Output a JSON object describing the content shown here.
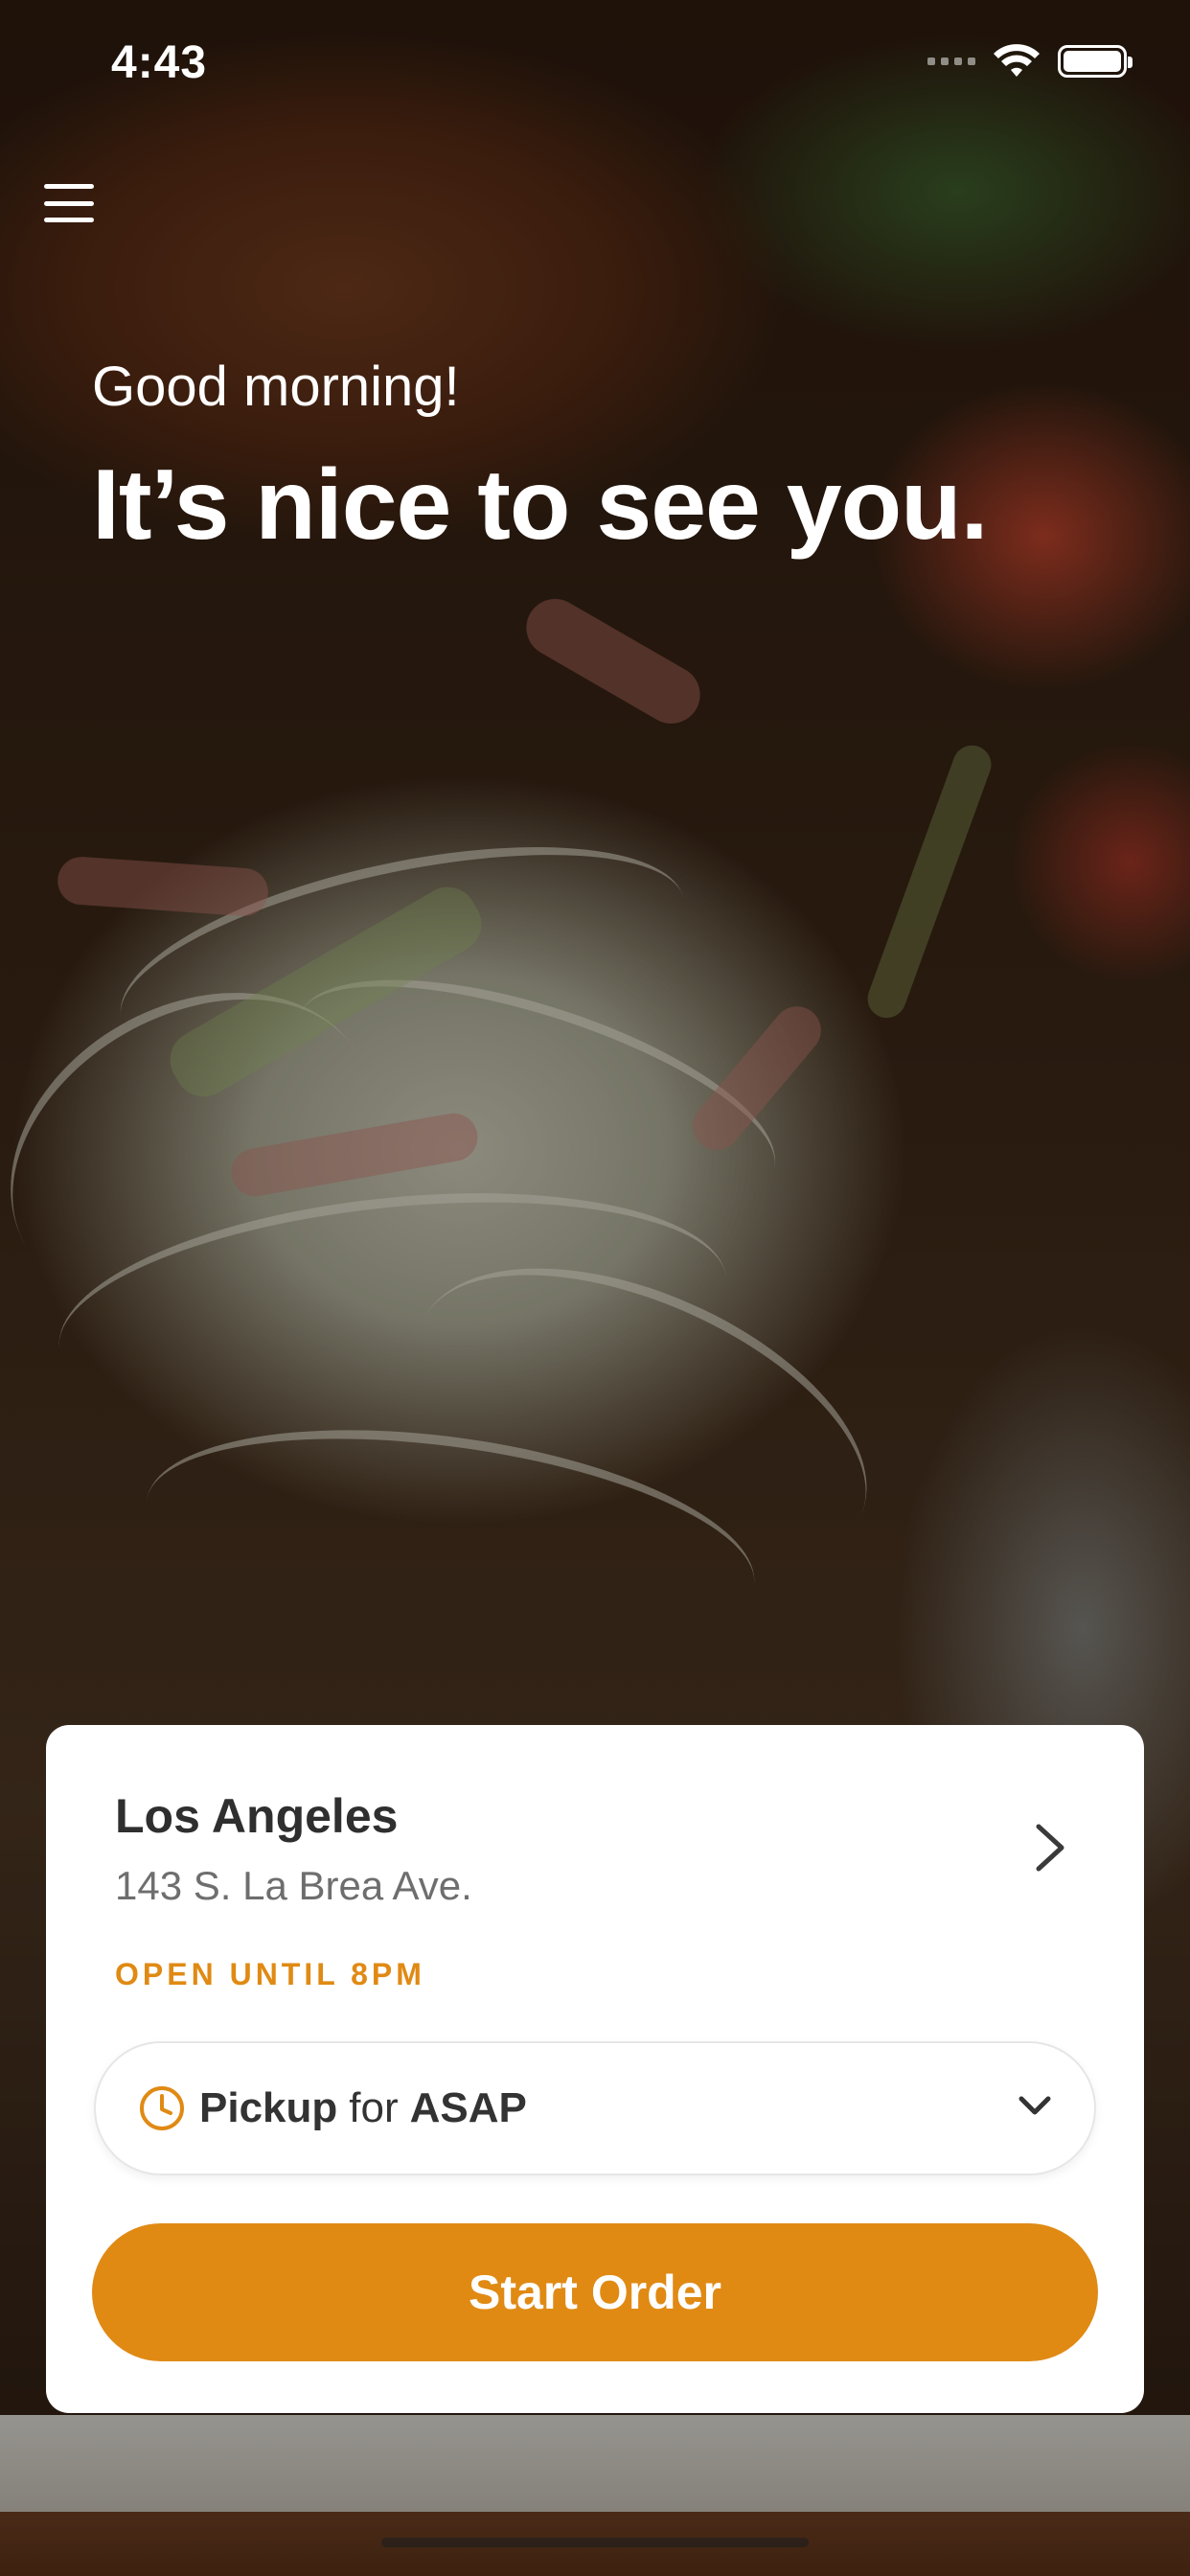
{
  "status_bar": {
    "time": "4:43"
  },
  "hero": {
    "greeting": "Good morning!",
    "headline": "It’s nice to see you."
  },
  "location": {
    "city": "Los Angeles",
    "address": "143 S. La Brea Ave.",
    "hours": "OPEN UNTIL 8PM"
  },
  "order_mode": {
    "mode": "Pickup",
    "connector": "for",
    "time": "ASAP"
  },
  "actions": {
    "start_order": "Start Order"
  },
  "colors": {
    "accent": "#e08a14",
    "card": "#ffffff",
    "text_dark": "#2f2f2f"
  },
  "icons": {
    "menu": "hamburger-icon",
    "location_arrow": "chevron-right-icon",
    "time": "clock-icon",
    "dropdown": "chevron-down-icon"
  }
}
